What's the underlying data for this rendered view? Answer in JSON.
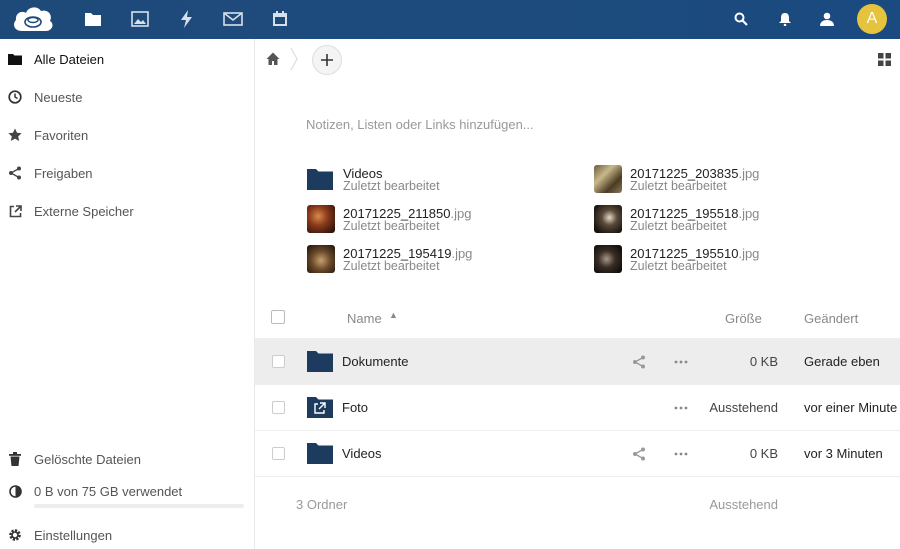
{
  "header": {
    "apps": [
      "files-icon",
      "gallery-icon",
      "activity-icon",
      "mail-icon",
      "calendar-icon"
    ],
    "right_icons": [
      "search-icon",
      "notifications-icon",
      "contacts-icon"
    ],
    "avatar_letter": "A",
    "avatar_color": "#e5c33c",
    "brand_color": "#1e4a7a"
  },
  "sidebar": {
    "items": [
      {
        "label": "Alle Dateien",
        "icon": "folder-icon"
      },
      {
        "label": "Neueste",
        "icon": "clock-icon"
      },
      {
        "label": "Favoriten",
        "icon": "star-icon"
      },
      {
        "label": "Freigaben",
        "icon": "share-icon"
      },
      {
        "label": "Externe Speicher",
        "icon": "external-icon"
      }
    ],
    "deleted_label": "Gelöschte Dateien",
    "quota_label": "0 B von 75 GB verwendet",
    "quota_used_fraction": 0,
    "settings_label": "Einstellungen"
  },
  "main": {
    "notes_placeholder": "Notizen, Listen oder Links hinzufügen...",
    "recent": [
      {
        "base": "Videos",
        "ext": "",
        "sub": "Zuletzt bearbeitet"
      },
      {
        "base": "20171225_203835",
        "ext": ".jpg",
        "sub": "Zuletzt bearbeitet"
      },
      {
        "base": "20171225_211850",
        "ext": ".jpg",
        "sub": "Zuletzt bearbeitet"
      },
      {
        "base": "20171225_195518",
        "ext": ".jpg",
        "sub": "Zuletzt bearbeitet"
      },
      {
        "base": "20171225_195419",
        "ext": ".jpg",
        "sub": "Zuletzt bearbeitet"
      },
      {
        "base": "20171225_195510",
        "ext": ".jpg",
        "sub": "Zuletzt bearbeitet"
      }
    ],
    "table": {
      "col_name": "Name",
      "col_size": "Größe",
      "col_modified": "Geändert",
      "rows": [
        {
          "name": "Dokumente",
          "size": "0 KB",
          "modified": "Gerade eben"
        },
        {
          "name": "Foto",
          "size": "Ausstehend",
          "modified": "vor einer Minute"
        },
        {
          "name": "Videos",
          "size": "0 KB",
          "modified": "vor 3 Minuten"
        }
      ],
      "summary": "3 Ordner",
      "summary_size": "Ausstehend"
    }
  }
}
